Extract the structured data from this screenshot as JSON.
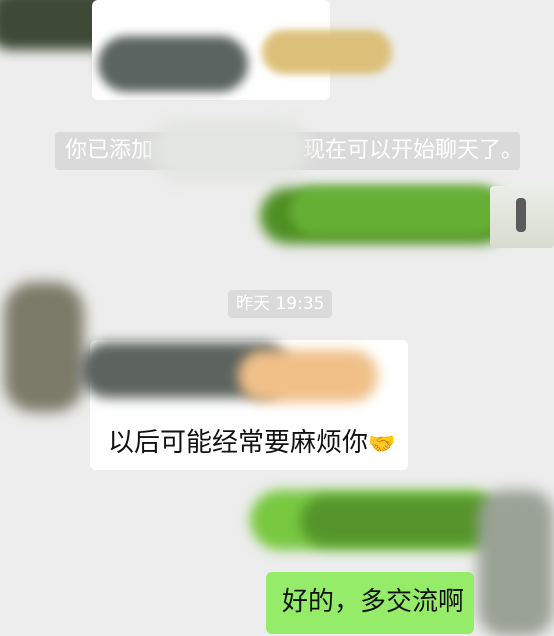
{
  "chat": {
    "system_message": "你已添加                              现在可以开始聊天了。",
    "system_prefix": "你已添加",
    "system_suffix": "现在可以开始聊天了。",
    "timestamp": "昨天 19:35",
    "messages": [
      {
        "side": "incoming",
        "text": "以后可能经常要麻烦你",
        "emoji": "🤝"
      },
      {
        "side": "outgoing",
        "text": "好的，多交流啊"
      }
    ]
  },
  "colors": {
    "background": "#ededed",
    "incoming_bubble": "#ffffff",
    "outgoing_bubble": "#95ec69",
    "system_pill": "#dadada"
  }
}
